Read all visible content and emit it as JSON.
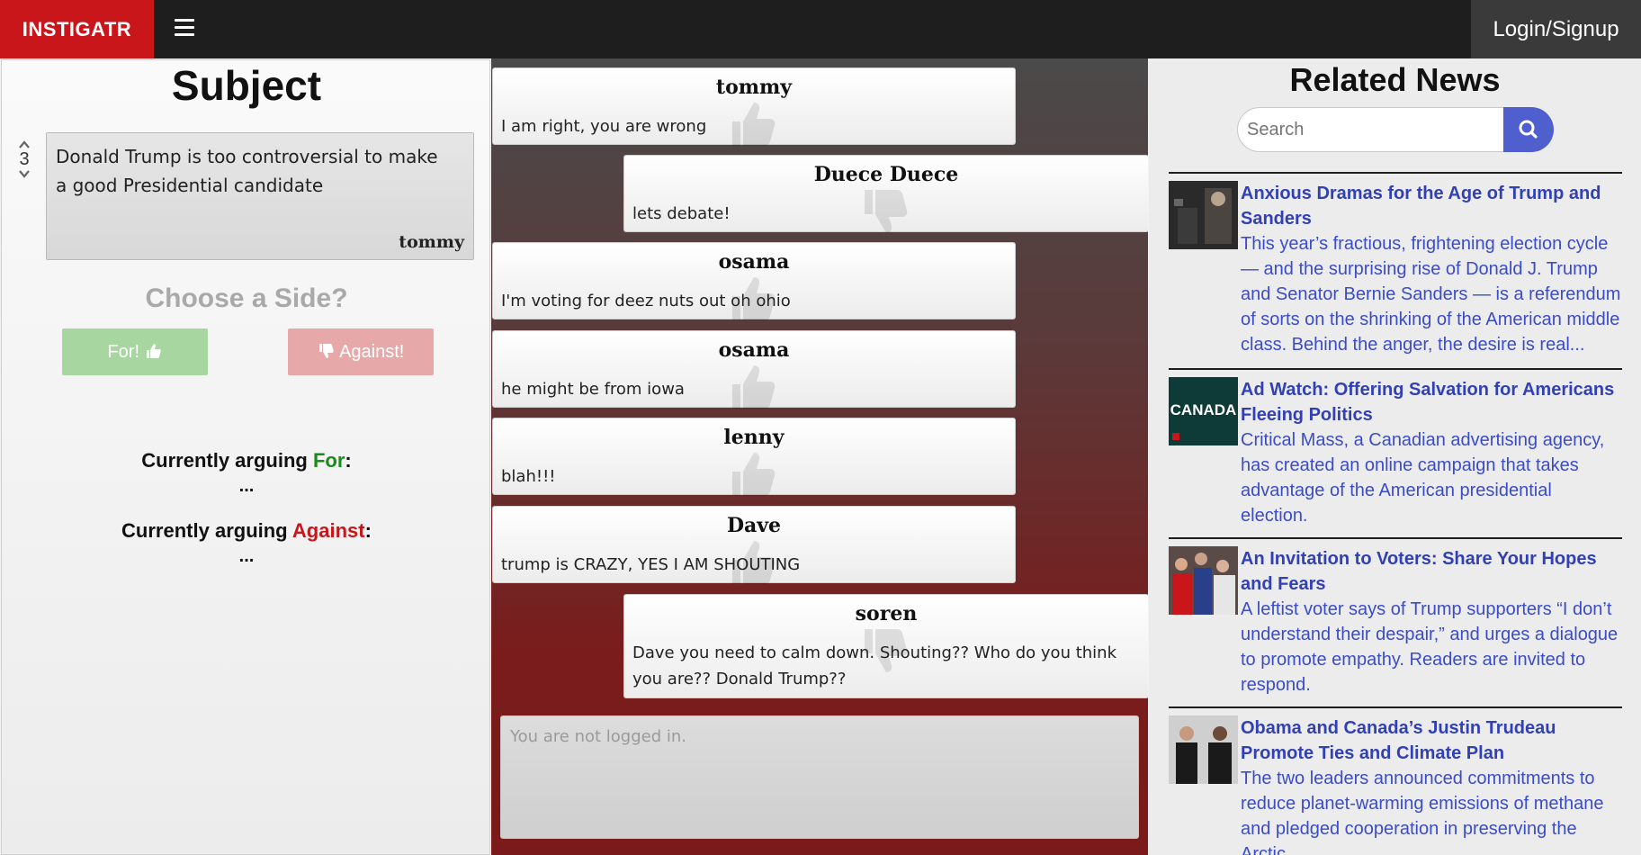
{
  "nav": {
    "brand": "INSTIGATR",
    "login_label": "Login/Signup"
  },
  "subject": {
    "heading": "Subject",
    "votes": "3",
    "text": "Donald Trump is too controversial to make a good Presidential candidate",
    "author": "tommy",
    "choose_label": "Choose a Side?",
    "for_label": "For!",
    "against_label": "Against!",
    "arguing_prefix": "Currently arguing ",
    "arguing_for_word": "For",
    "arguing_against_word": "Against",
    "colon": ":",
    "for_list": "...",
    "against_list": "..."
  },
  "messages": [
    {
      "author": "tommy",
      "text": "I am right, you are wrong",
      "side": "for"
    },
    {
      "author": "Duece Duece",
      "text": "lets debate!",
      "side": "against"
    },
    {
      "author": "osama",
      "text": "I'm voting for deez nuts out oh ohio",
      "side": "for"
    },
    {
      "author": "osama",
      "text": "he might be from iowa",
      "side": "for"
    },
    {
      "author": "lenny",
      "text": "blah!!!",
      "side": "for"
    },
    {
      "author": "Dave",
      "text": "trump is CRAZY, YES I AM SHOUTING",
      "side": "for"
    },
    {
      "author": "soren",
      "text": "Dave you need to calm down. Shouting?? Who do you think you are?? Donald Trump??",
      "side": "against"
    }
  ],
  "compose": {
    "placeholder": "You are not logged in."
  },
  "news": {
    "heading": "Related News",
    "search_placeholder": "Search",
    "items": [
      {
        "title": "Anxious Dramas for the Age of Trump and Sanders",
        "desc": "This year’s fractious, frightening election cycle — and the surprising rise of Donald J. Trump and Senator Bernie Sanders — is a referendum of sorts on the shrinking of the American middle class. Behind the anger, the desire is real...",
        "thumb": "dark-stage-photo"
      },
      {
        "title": "Ad Watch: Offering Salvation for Americans Fleeing Politics",
        "desc": "Critical Mass, a Canadian advertising agency, has created an online campaign that takes advantage of the American presidential election.",
        "thumb": "canada-ad-photo",
        "thumb_text": "CANADA"
      },
      {
        "title": "An Invitation to Voters: Share Your Hopes and Fears",
        "desc": "A leftist voter says of Trump supporters “I don’t understand their despair,” and urges a dialogue to promote empathy. Readers are invited to respond.",
        "thumb": "crowd-photo"
      },
      {
        "title": "Obama and Canada’s Justin Trudeau Promote Ties and Climate Plan",
        "desc": "The two leaders announced commitments to reduce planet-warming emissions of methane and pledged cooperation in preserving the Arctic.",
        "thumb": "leaders-photo"
      }
    ]
  }
}
